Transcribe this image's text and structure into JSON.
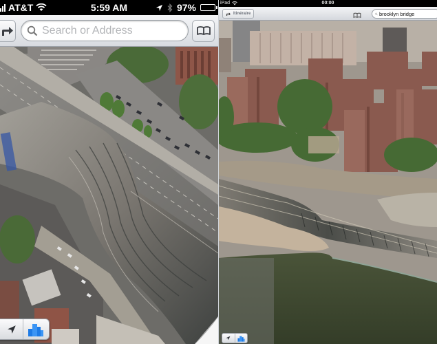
{
  "left_screenshot": {
    "device": "iPhone",
    "status_bar": {
      "carrier": "AT&T",
      "time": "5:59 AM",
      "battery_percent_label": "97%",
      "battery_level": 0.97,
      "icons": [
        "signal-bars-icon",
        "wifi-icon",
        "location-arrow-icon",
        "bluetooth-icon",
        "battery-icon"
      ]
    },
    "toolbar": {
      "directions_button_icon": "turn-right-arrow-icon",
      "search_placeholder": "Search or Address",
      "search_value": "",
      "bookmarks_button_icon": "book-icon"
    },
    "map": {
      "view": "3D flyover satellite",
      "description": "Distorted 3D rendering of an elevated highway/bridge ramp next to a city street with parked cars, trees and brick buildings"
    },
    "bottom_controls": {
      "locate_button_icon": "location-arrow-icon",
      "view_3d_button_icon": "buildings-3d-icon",
      "page_curl_icon": "page-curl-icon"
    }
  },
  "right_screenshot": {
    "device": "iPad",
    "status_bar": {
      "device_label": "iPad",
      "time": "00:00",
      "icons": [
        "wifi-icon"
      ]
    },
    "toolbar": {
      "directions_button_label": "Itinéraire",
      "directions_button_icon": "turn-right-arrow-icon",
      "bookmarks_button_icon": "book-icon",
      "search_value": "brooklyn bridge",
      "search_placeholder": ""
    },
    "map": {
      "view": "3D flyover satellite",
      "description": "Red-brick housing towers among trees above a warped, melting rendering of the Brooklyn Bridge approach over dark green river water"
    },
    "bottom_controls": {
      "locate_button_icon": "location-arrow-icon",
      "view_3d_button_icon": "buildings-3d-icon"
    }
  },
  "colors": {
    "toolbar_top": "#f4f5f7",
    "toolbar_bottom": "#d8dbe0",
    "status_bar": "#000000",
    "accent_3d_blue": "#2f8ef0",
    "river_water": "#3b4630",
    "brick_buildings": "#8a5a4f"
  }
}
